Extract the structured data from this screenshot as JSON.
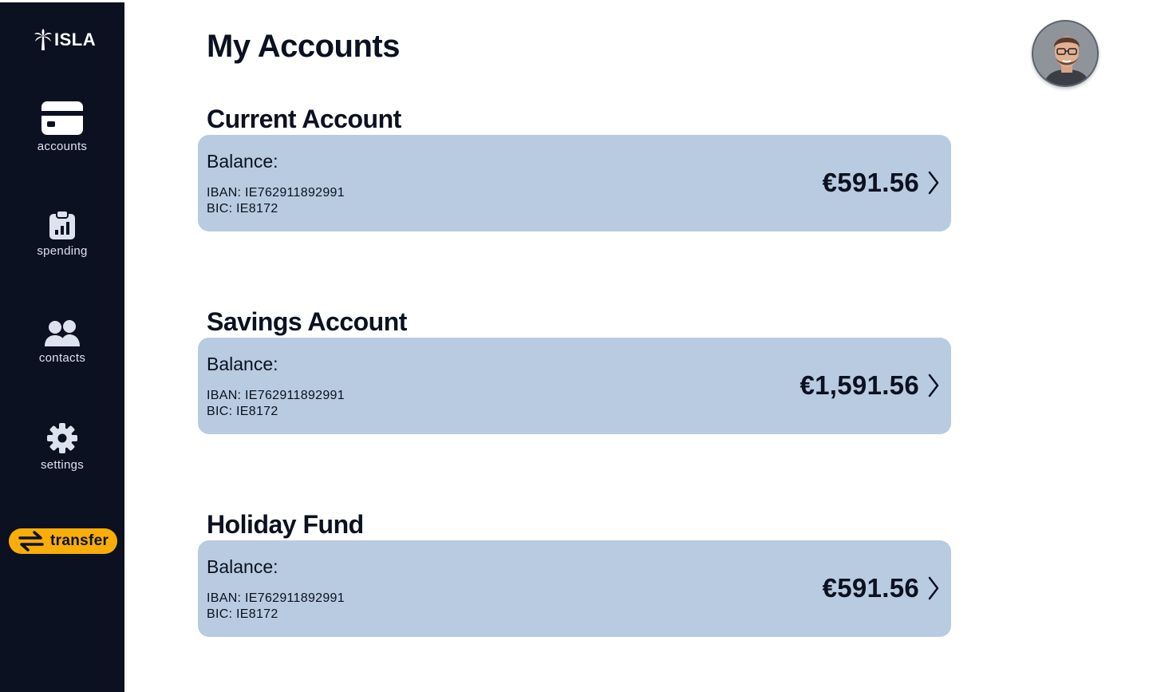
{
  "app": {
    "brand": "ISLA"
  },
  "sidebar": {
    "items": [
      {
        "label": "accounts",
        "icon": "credit-card-icon"
      },
      {
        "label": "spending",
        "icon": "clipboard-chart-icon"
      },
      {
        "label": "contacts",
        "icon": "users-icon"
      },
      {
        "label": "settings",
        "icon": "gear-icon"
      }
    ],
    "transfer": {
      "label": "transfer",
      "icon": "arrows-exchange-icon"
    }
  },
  "header": {
    "title": "My Accounts"
  },
  "accounts": [
    {
      "name": "Current Account",
      "balance_label": "Balance:",
      "iban": "IBAN: IE762911892991",
      "bic": "BIC: IE8172",
      "balance": "€591.56"
    },
    {
      "name": "Savings Account",
      "balance_label": "Balance:",
      "iban": "IBAN: IE762911892991",
      "bic": "BIC: IE8172",
      "balance": "€1,591.56"
    },
    {
      "name": "Holiday Fund",
      "balance_label": "Balance:",
      "iban": "IBAN: IE762911892991",
      "bic": "BIC: IE8172",
      "balance": "€591.56"
    }
  ],
  "colors": {
    "sidebar_bg": "#0b1120",
    "card_bg": "#b8cbe0",
    "accent": "#f8ad08",
    "text": "#0b1120"
  }
}
